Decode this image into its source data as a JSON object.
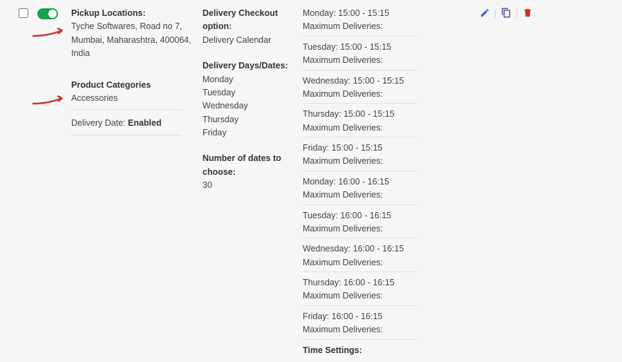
{
  "row": {
    "col_a": {
      "pickup_label": "Pickup Locations:",
      "pickup_value": "Tyche Softwares, Road no 7, Mumbai, Maharashtra, 400064, India",
      "pcat_label": "Product Categories",
      "pcat_value": "Accessories",
      "ddate_label": "Delivery Date:",
      "ddate_value": "Enabled"
    },
    "col_b": {
      "dco_label": "Delivery Checkout option:",
      "dco_value": "Delivery Calendar",
      "dd_label": "Delivery Days/Dates:",
      "days": [
        "Monday",
        "Tuesday",
        "Wednesday",
        "Thursday",
        "Friday"
      ],
      "ndc_label": "Number of dates to choose:",
      "ndc_value": "30"
    },
    "col_c": {
      "slots": [
        {
          "time": "Monday: 15:00 - 15:15",
          "max": "Maximum Deliveries:"
        },
        {
          "time": "Tuesday: 15:00 - 15:15",
          "max": "Maximum Deliveries:"
        },
        {
          "time": "Wednesday: 15:00 - 15:15",
          "max": "Maximum Deliveries:"
        },
        {
          "time": "Thursday: 15:00 - 15:15",
          "max": "Maximum Deliveries:"
        },
        {
          "time": "Friday: 15:00 - 15:15",
          "max": "Maximum Deliveries:"
        },
        {
          "time": "Monday: 16:00 - 16:15",
          "max": "Maximum Deliveries:"
        },
        {
          "time": "Tuesday: 16:00 - 16:15",
          "max": "Maximum Deliveries:"
        },
        {
          "time": "Wednesday: 16:00 - 16:15",
          "max": "Maximum Deliveries:"
        },
        {
          "time": "Thursday: 16:00 - 16:15",
          "max": "Maximum Deliveries:"
        },
        {
          "time": "Friday: 16:00 - 16:15",
          "max": "Maximum Deliveries:"
        }
      ],
      "timesettings_label": "Time Settings:"
    }
  }
}
